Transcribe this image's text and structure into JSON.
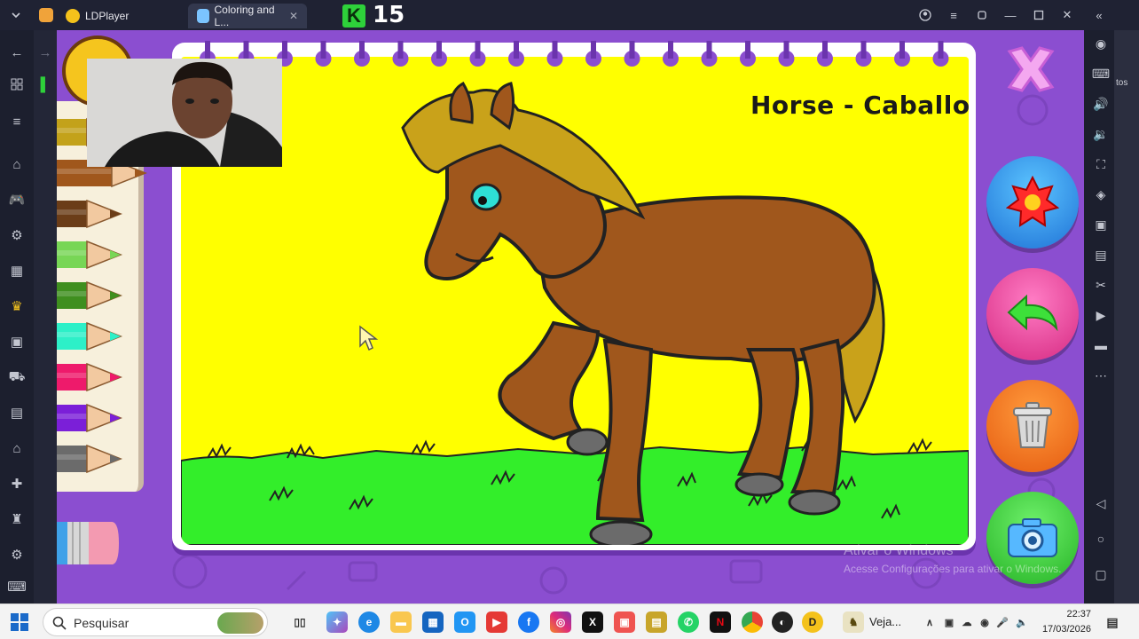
{
  "titlebar": {
    "tabs": [
      {
        "label": "LDPlayer",
        "icon": "ldplayer-icon"
      },
      {
        "label": "Coloring and L...",
        "icon": "game-icon"
      }
    ],
    "counter_number": "15",
    "accent": "#2ed13a"
  },
  "game": {
    "drawing_title": "Horse - Caballo",
    "colors": {
      "background": "#8b4ed0",
      "canvas_yellow": "#ffff00",
      "grass_green": "#33ff33",
      "horse_brown": "#a0571c",
      "mane_gold": "#c9a21a"
    },
    "pencils": [
      {
        "color": "#c3a21a",
        "name": "gold"
      },
      {
        "color": "#a0571c",
        "name": "brown"
      },
      {
        "color": "#6b3d18",
        "name": "dark-brown"
      },
      {
        "color": "#78d656",
        "name": "light-green"
      },
      {
        "color": "#3f8f1f",
        "name": "green"
      },
      {
        "color": "#2df0c8",
        "name": "turquoise"
      },
      {
        "color": "#ee1a6b",
        "name": "pink"
      },
      {
        "color": "#7b1fd8",
        "name": "purple"
      },
      {
        "color": "#6b6b6b",
        "name": "gray"
      }
    ],
    "side_buttons": [
      {
        "name": "stamp-button",
        "icon": "star-badge-icon",
        "color": "#1f8fe8"
      },
      {
        "name": "undo-button",
        "icon": "undo-arrow-icon",
        "color": "#e8338f"
      },
      {
        "name": "clear-button",
        "icon": "trash-can-icon",
        "color": "#f26a1b"
      },
      {
        "name": "save-photo-button",
        "icon": "camera-icon",
        "color": "#3ccf3c"
      }
    ]
  },
  "watermark": {
    "line1": "Ativar o Windows",
    "line2": "Acesse Configurações para ativar o Windows."
  },
  "taskbar": {
    "search_placeholder": "Pesquisar",
    "running_app_label": "Veja...",
    "time": "22:37",
    "date": "17/03/2026",
    "partial_right_text": "tos"
  }
}
